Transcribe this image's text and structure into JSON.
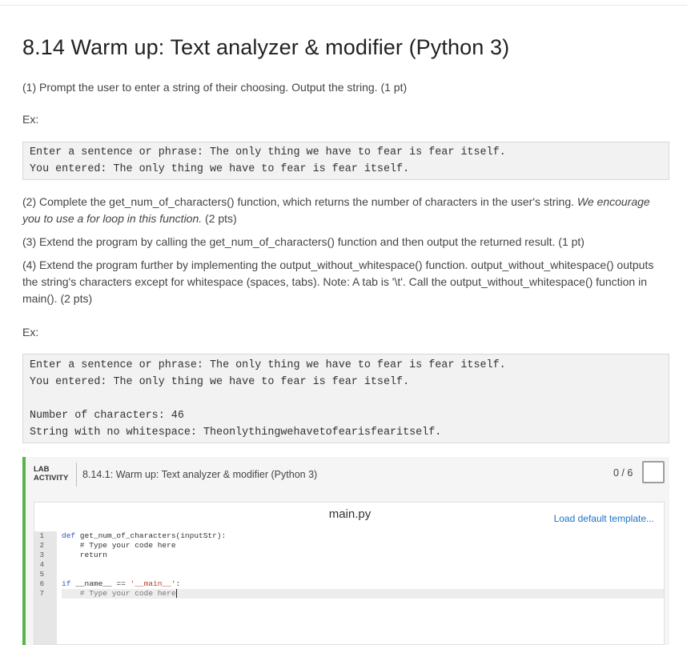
{
  "title": "8.14 Warm up: Text analyzer & modifier (Python 3)",
  "step1": "(1) Prompt the user to enter a string of their choosing. Output the string. (1 pt)",
  "ex_label": "Ex:",
  "example1": [
    "Enter a sentence or phrase: The only thing we have to fear is fear itself.",
    "You entered: The only thing we have to fear is fear itself."
  ],
  "step2_a": "(2) Complete the get_num_of_characters() function, which returns the number of characters in the user's string. ",
  "step2_b": "We encourage you to use a for loop in this function.",
  "step2_c": " (2 pts)",
  "step3": "(3) Extend the program by calling the get_num_of_characters() function and then output the returned result. (1 pt)",
  "step4": "(4) Extend the program further by implementing the output_without_whitespace() function. output_without_whitespace() outputs the string's characters except for whitespace (spaces, tabs). Note: A tab is '\\t'. Call the output_without_whitespace() function in main(). (2 pts)",
  "example2": [
    "Enter a sentence or phrase: The only thing we have to fear is fear itself.",
    "You entered: The only thing we have to fear is fear itself.",
    "",
    "Number of characters: 46",
    "String with no whitespace: Theonlythingwehavetofearisfearitself."
  ],
  "lab": {
    "tag_line1": "LAB",
    "tag_line2": "ACTIVITY",
    "title": "8.14.1: Warm up: Text analyzer & modifier (Python 3)",
    "score": "0 / 6",
    "accent": "#5ab349"
  },
  "editor": {
    "filename": "main.py",
    "load_template": "Load default template...",
    "line_numbers": [
      "1",
      "2",
      "3",
      "4",
      "5",
      "6",
      "7"
    ],
    "code": {
      "l1_kw": "def",
      "l1_rest": " get_num_of_characters(inputStr):",
      "l2": "    # Type your code here",
      "l3": "    return",
      "l6_kw": "if",
      "l6_mid": " __name__ == ",
      "l6_str": "'__main__'",
      "l6_end": ":",
      "l7": "    # Type your code here"
    }
  }
}
